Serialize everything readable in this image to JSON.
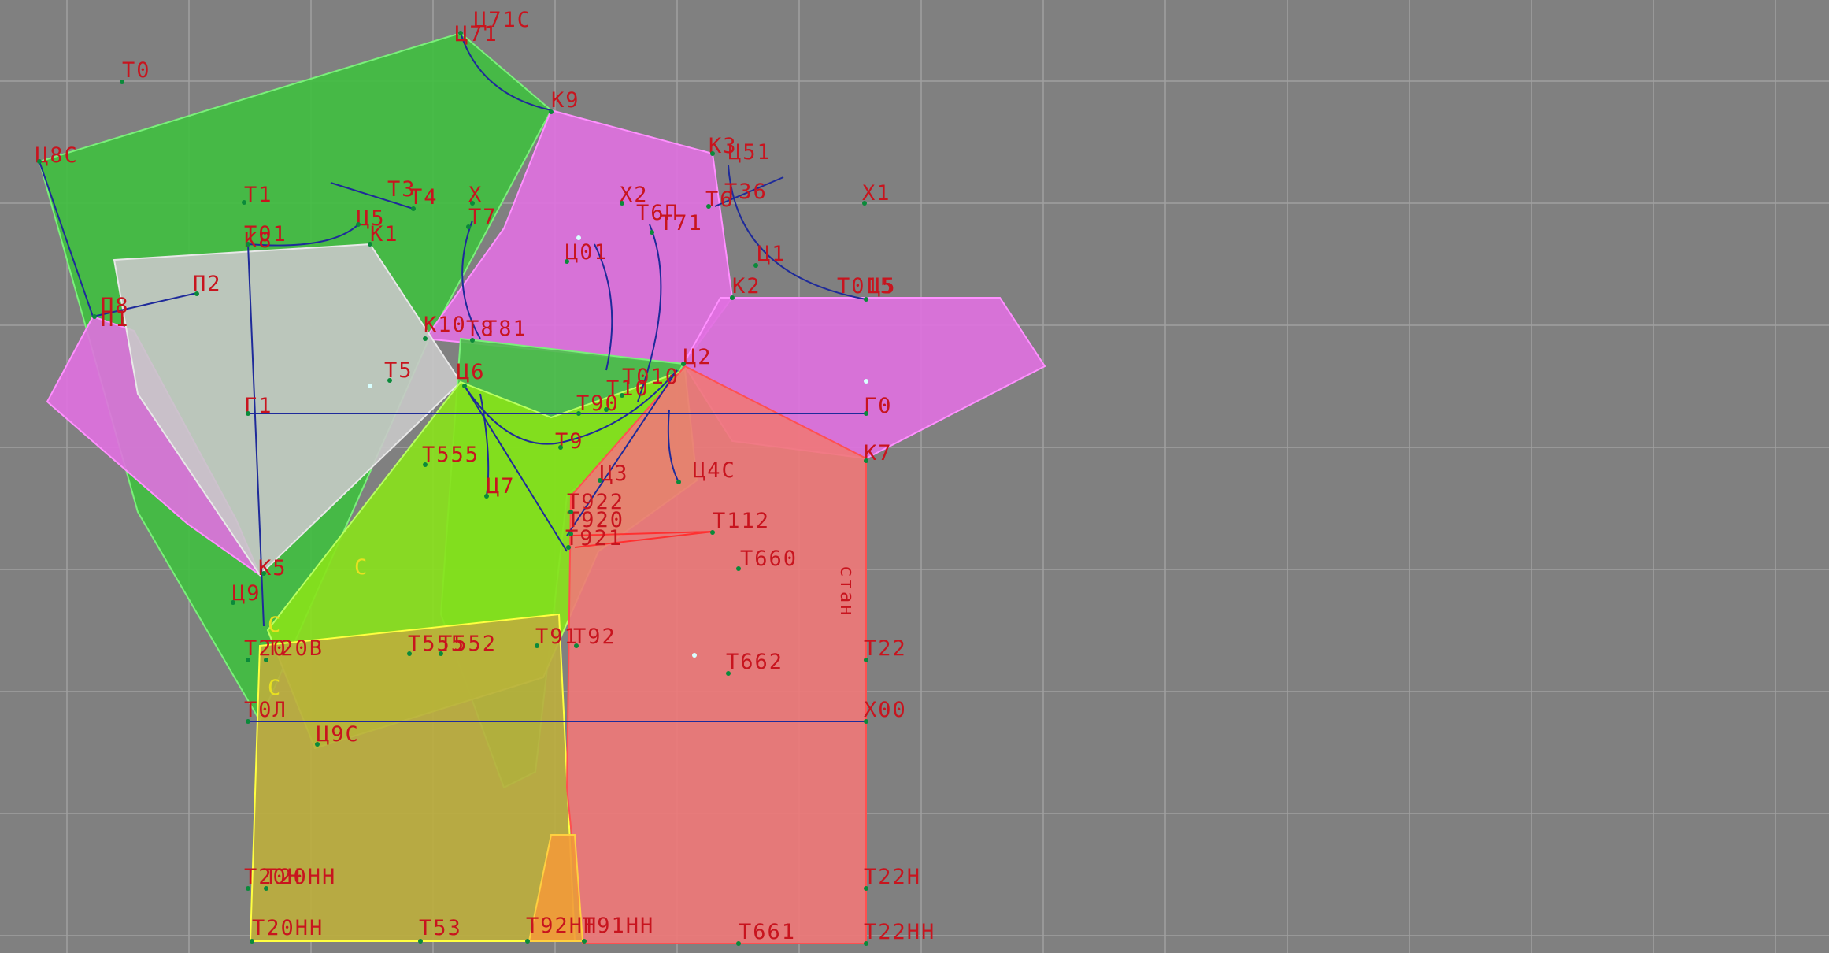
{
  "colors": {
    "background": "#808080",
    "grid": "#a0a0a0",
    "label": "#c8141e",
    "construction_line": "#1e2a9a",
    "point_marker": "#0a8a3a",
    "piece_green": "#3fbf3f",
    "piece_magenta": "#e070e0",
    "piece_gray": "#c8c8c8",
    "piece_lime": "#88e21a",
    "piece_olive": "#bdae3c",
    "piece_red": "#f07878",
    "piece_orange": "#f29a3a"
  },
  "pieces": [
    {
      "name": "front-bodice-green",
      "color": "#3fbf3f",
      "edge": "#7af07a"
    },
    {
      "name": "sleeve-magenta-left",
      "color": "#e070e0",
      "edge": "#ff90ff"
    },
    {
      "name": "yoke-magenta",
      "color": "#e070e0",
      "edge": "#ff90ff"
    },
    {
      "name": "sleeve-magenta-right",
      "color": "#e070e0",
      "edge": "#ff90ff"
    },
    {
      "name": "sleeve-gray",
      "color": "#c8c8c8",
      "edge": "#e8e8e8"
    },
    {
      "name": "side-green",
      "color": "#48c048",
      "edge": "#7af07a"
    },
    {
      "name": "front-lime",
      "color": "#88e21a",
      "edge": "#b8ff60"
    },
    {
      "name": "skirt-olive",
      "color": "#bdae3c",
      "edge": "#ffff40"
    },
    {
      "name": "back-red",
      "color": "#f07878",
      "edge": "#ff5050"
    },
    {
      "name": "hem-orange",
      "color": "#f29a3a",
      "edge": "#ffd040"
    }
  ],
  "labels": [
    {
      "text": "Ц71С"
    },
    {
      "text": "Ц71"
    },
    {
      "text": "Т0"
    },
    {
      "text": "К9"
    },
    {
      "text": "Ц8С"
    },
    {
      "text": "К3"
    },
    {
      "text": "Ц51"
    },
    {
      "text": "Т1"
    },
    {
      "text": "Т3"
    },
    {
      "text": "Т4"
    },
    {
      "text": "Х"
    },
    {
      "text": "Х2"
    },
    {
      "text": "Т6П"
    },
    {
      "text": "Т71"
    },
    {
      "text": "Т6"
    },
    {
      "text": "Т36"
    },
    {
      "text": "Х1"
    },
    {
      "text": "Ц5"
    },
    {
      "text": "Т7"
    },
    {
      "text": "Т01"
    },
    {
      "text": "К1"
    },
    {
      "text": "К8"
    },
    {
      "text": "Ц01"
    },
    {
      "text": "Ц1"
    },
    {
      "text": "П2"
    },
    {
      "text": "К2"
    },
    {
      "text": "Т015"
    },
    {
      "text": "Ц5"
    },
    {
      "text": "П8"
    },
    {
      "text": "П1"
    },
    {
      "text": "К10"
    },
    {
      "text": "Т8"
    },
    {
      "text": "Т81"
    },
    {
      "text": "Ц2"
    },
    {
      "text": "Т5"
    },
    {
      "text": "Ц6"
    },
    {
      "text": "Т010"
    },
    {
      "text": "Т10"
    },
    {
      "text": "Г1"
    },
    {
      "text": "Т90"
    },
    {
      "text": "Г0"
    },
    {
      "text": "Т9"
    },
    {
      "text": "К7"
    },
    {
      "text": "Т555"
    },
    {
      "text": "Ц3"
    },
    {
      "text": "Ц4С"
    },
    {
      "text": "Ц7"
    },
    {
      "text": "Т922"
    },
    {
      "text": "Т920"
    },
    {
      "text": "Т112"
    },
    {
      "text": "Т921"
    },
    {
      "text": "Т660"
    },
    {
      "text": "К5"
    },
    {
      "text": "Ц9"
    },
    {
      "text": "Т20"
    },
    {
      "text": "Т20В"
    },
    {
      "text": "Т555"
    },
    {
      "text": "Т552"
    },
    {
      "text": "Т91"
    },
    {
      "text": "Т92"
    },
    {
      "text": "Т22"
    },
    {
      "text": "Т662"
    },
    {
      "text": "Т0Л"
    },
    {
      "text": "Х00"
    },
    {
      "text": "Ц9С"
    },
    {
      "text": "Т20Н"
    },
    {
      "text": "Т20НН"
    },
    {
      "text": "Т22Н"
    },
    {
      "text": "Т20НН"
    },
    {
      "text": "Т53"
    },
    {
      "text": "Т92НН"
    },
    {
      "text": "Т91НН"
    },
    {
      "text": "Т661"
    },
    {
      "text": "Т22НН"
    },
    {
      "text": "стан"
    },
    {
      "text": "С"
    },
    {
      "text": "С"
    },
    {
      "text": "С"
    }
  ]
}
